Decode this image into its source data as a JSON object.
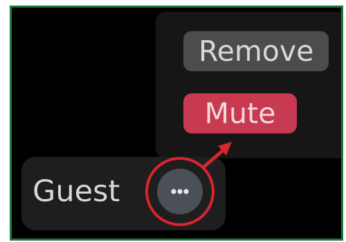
{
  "menu": {
    "remove_label": "Remove",
    "mute_label": "Mute"
  },
  "participant": {
    "name": "Guest",
    "more_icon": "more-horizontal-icon"
  },
  "colors": {
    "frame_border": "#1c7a3c",
    "mute_accent": "#c73a50",
    "highlight_ring": "#d8252f",
    "remove_bg": "#4b4c4e"
  }
}
